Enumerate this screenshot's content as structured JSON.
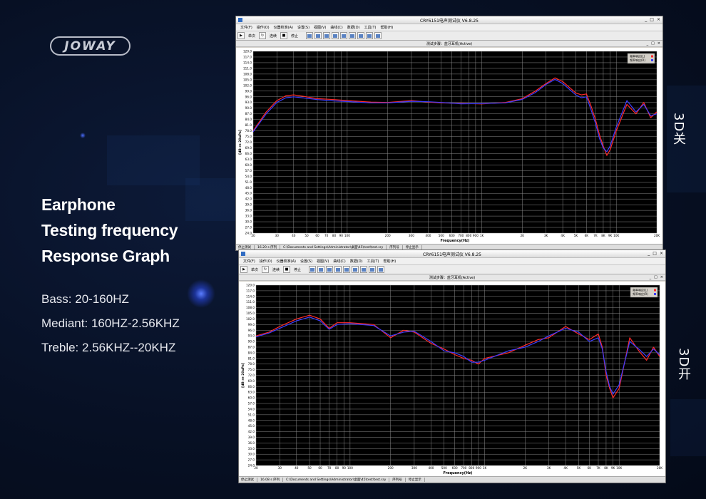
{
  "logo": {
    "text": "JOWAY"
  },
  "headings": [
    "Earphone",
    "Testing frequency",
    "Response Graph"
  ],
  "specs": [
    {
      "label": "Bass:",
      "value": "20-160HZ"
    },
    {
      "label": "Mediant:",
      "value": "160HZ-2.56KHZ"
    },
    {
      "label": "Treble:",
      "value": "2.56KHZ--20KHZ"
    }
  ],
  "side_labels": [
    "3D关",
    "3D开"
  ],
  "windows": [
    {
      "title": "CRY6151电声测试仪 V6.8.25",
      "subtitle": "测试步骤：蓝牙耳机(Active)",
      "menu": [
        "文件(F)",
        "操作(O)",
        "仪器校准(A)",
        "设置(S)",
        "视图(V)",
        "曲线(C)",
        "数据(D)",
        "工具(T)",
        "帮助(H)"
      ],
      "toolbar": [
        "单次",
        "连续",
        "停止"
      ],
      "legend": [
        "频率响应(L)",
        "频率响应(R)"
      ],
      "status": [
        "停止测试",
        "16.20 s 序列",
        "C:\\Documents and Settings\\Administrator\\桌面\\45\\test\\test.sry",
        "序列号",
        "停止显示"
      ]
    },
    {
      "title": "CRY6151电声测试仪 V6.8.25",
      "subtitle": "测试步骤：蓝牙耳机(Active)",
      "menu": [
        "文件(F)",
        "操作(O)",
        "仪器校准(A)",
        "设置(S)",
        "视图(V)",
        "曲线(C)",
        "数据(D)",
        "工具(T)",
        "帮助(H)"
      ],
      "toolbar": [
        "单次",
        "连续",
        "停止"
      ],
      "legend": [
        "频率响应(L)",
        "频率响应(R)"
      ],
      "status": [
        "停止测试",
        "16.08 s 序列",
        "C:\\Documents and Settings\\Administrator\\桌面\\45\\test\\test.sry",
        "序列号",
        "停止显示"
      ]
    }
  ],
  "chart_data": [
    {
      "type": "line",
      "xlabel": "Frequency(Hz)",
      "ylabel": "[dB re 20uPa]",
      "x_scale": "log",
      "xlim": [
        20,
        20000
      ],
      "ylim": [
        24.0,
        120.0
      ],
      "y_ticks": [
        "120.0",
        "117.0",
        "114.0",
        "111.0",
        "108.0",
        "105.0",
        "102.0",
        "99.0",
        "96.0",
        "93.0",
        "90.0",
        "87.0",
        "84.0",
        "81.0",
        "78.0",
        "75.0",
        "72.0",
        "69.0",
        "66.0",
        "63.0",
        "60.0",
        "57.0",
        "54.0",
        "51.0",
        "48.0",
        "45.0",
        "42.0",
        "39.0",
        "36.0",
        "33.0",
        "30.0",
        "27.0",
        "24.0"
      ],
      "x_ticks": [
        "20",
        "30",
        "40",
        "50",
        "60",
        "70",
        "80",
        "90",
        "100",
        "200",
        "300",
        "400",
        "500",
        "600",
        "700",
        "800",
        "900",
        "1K",
        "2K",
        "3K",
        "4K",
        "5K",
        "6K",
        "7K",
        "8K",
        "9K",
        "10K",
        "20K"
      ],
      "x_tick_values": [
        20,
        30,
        40,
        50,
        60,
        70,
        80,
        90,
        100,
        200,
        300,
        400,
        500,
        600,
        700,
        800,
        900,
        1000,
        2000,
        3000,
        4000,
        5000,
        6000,
        7000,
        8000,
        9000,
        10000,
        20000
      ],
      "grid": true,
      "legend_position": "top-right",
      "series": [
        {
          "name": "频率响应(L)",
          "color": "#ff2a2a",
          "x": [
            20,
            25,
            30,
            35,
            40,
            50,
            60,
            80,
            100,
            150,
            200,
            300,
            400,
            500,
            700,
            1000,
            1500,
            2000,
            2500,
            3000,
            3500,
            4000,
            5000,
            5500,
            6000,
            6500,
            7000,
            7500,
            8000,
            8500,
            9000,
            10000,
            12000,
            14000,
            16000,
            18000,
            20000
          ],
          "y": [
            78,
            88,
            94,
            96.5,
            97,
            96,
            95,
            94.5,
            94,
            93.2,
            93,
            94,
            93.2,
            92.8,
            92.5,
            92.2,
            93,
            95,
            99,
            103,
            106,
            104,
            98,
            97,
            97.5,
            91,
            84,
            76,
            70,
            65,
            68,
            78,
            92,
            87,
            93,
            85,
            88
          ]
        },
        {
          "name": "频率响应(R)",
          "color": "#3d3dff",
          "x": [
            20,
            25,
            30,
            35,
            40,
            50,
            60,
            80,
            100,
            150,
            200,
            300,
            400,
            500,
            700,
            1000,
            1500,
            2000,
            2500,
            3000,
            3500,
            4000,
            5000,
            5500,
            6000,
            6500,
            7000,
            7500,
            8000,
            8500,
            9000,
            10000,
            12000,
            14000,
            16000,
            18000,
            20000
          ],
          "y": [
            77.5,
            87,
            93,
            95.5,
            96,
            95.2,
            94.5,
            93.8,
            93.5,
            92.8,
            92.8,
            93.6,
            93.4,
            93,
            92.3,
            92.4,
            92.8,
            94.6,
            98.2,
            102.5,
            105.2,
            103,
            97,
            95.5,
            96,
            89,
            82,
            74,
            69,
            67,
            70,
            80,
            94,
            88,
            92,
            86,
            87
          ]
        }
      ]
    },
    {
      "type": "line",
      "xlabel": "Frequency(Hz)",
      "ylabel": "[dB re 20uPa]",
      "x_scale": "log",
      "xlim": [
        20,
        20000
      ],
      "ylim": [
        24.0,
        120.0
      ],
      "y_ticks": [
        "120.0",
        "117.0",
        "114.0",
        "111.0",
        "108.0",
        "105.0",
        "102.0",
        "99.0",
        "96.0",
        "93.0",
        "90.0",
        "87.0",
        "84.0",
        "81.0",
        "78.0",
        "75.0",
        "72.0",
        "69.0",
        "66.0",
        "63.0",
        "60.0",
        "57.0",
        "54.0",
        "51.0",
        "48.0",
        "45.0",
        "42.0",
        "39.0",
        "36.0",
        "33.0",
        "30.0",
        "27.0",
        "24.0"
      ],
      "x_ticks": [
        "20",
        "30",
        "40",
        "50",
        "60",
        "70",
        "80",
        "90",
        "100",
        "200",
        "300",
        "400",
        "500",
        "600",
        "700",
        "800",
        "900",
        "1K",
        "2K",
        "3K",
        "4K",
        "5K",
        "6K",
        "7K",
        "8K",
        "9K",
        "10K",
        "20K"
      ],
      "x_tick_values": [
        20,
        30,
        40,
        50,
        60,
        70,
        80,
        90,
        100,
        200,
        300,
        400,
        500,
        600,
        700,
        800,
        900,
        1000,
        2000,
        3000,
        4000,
        5000,
        6000,
        7000,
        8000,
        9000,
        10000,
        20000
      ],
      "grid": true,
      "legend_position": "top-right",
      "series": [
        {
          "name": "频率响应(L)",
          "color": "#ff2a2a",
          "x": [
            20,
            25,
            30,
            40,
            50,
            60,
            70,
            80,
            100,
            150,
            200,
            250,
            300,
            400,
            500,
            600,
            700,
            800,
            900,
            1000,
            1500,
            2000,
            2500,
            3000,
            4000,
            5000,
            6000,
            7000,
            7500,
            8000,
            8500,
            9000,
            10000,
            12000,
            14000,
            16000,
            18000,
            20000
          ],
          "y": [
            93,
            95,
            98,
            102,
            104,
            102,
            97,
            100,
            100,
            99,
            92,
            96,
            95,
            89,
            86,
            83,
            81,
            80,
            78,
            81,
            84,
            88,
            91,
            92,
            98,
            94,
            91,
            94,
            87,
            72,
            65,
            60,
            65,
            92,
            85,
            80,
            87,
            82
          ]
        },
        {
          "name": "频率响应(R)",
          "color": "#3d3dff",
          "x": [
            20,
            25,
            30,
            40,
            50,
            60,
            70,
            80,
            100,
            150,
            200,
            250,
            300,
            400,
            500,
            600,
            700,
            800,
            900,
            1000,
            1500,
            2000,
            2500,
            3000,
            4000,
            5000,
            6000,
            7000,
            7500,
            8000,
            8500,
            9000,
            10000,
            12000,
            14000,
            16000,
            18000,
            20000
          ],
          "y": [
            92.5,
            94.5,
            97,
            101,
            103,
            101,
            96.5,
            99,
            99.5,
            98.5,
            93,
            95,
            95.5,
            90,
            85,
            84,
            82,
            79,
            79,
            80,
            85,
            87,
            90,
            93,
            97,
            95,
            90,
            92,
            86,
            74,
            66,
            62,
            67,
            90,
            86,
            82,
            86,
            83
          ]
        }
      ]
    }
  ]
}
